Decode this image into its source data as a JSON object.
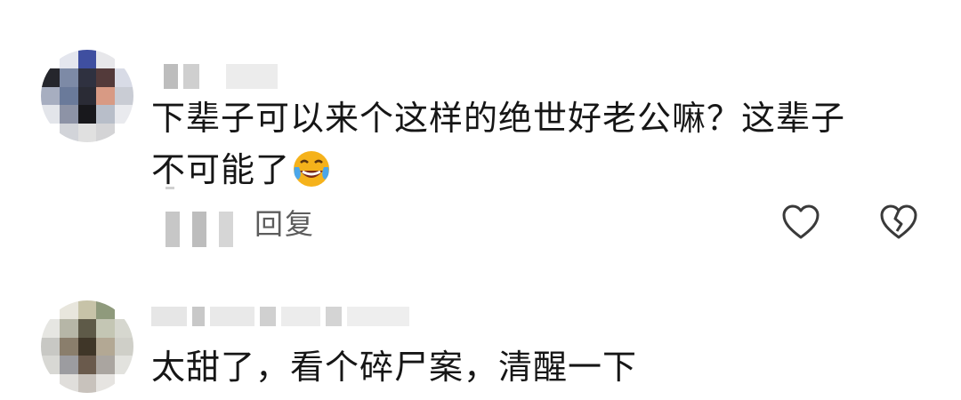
{
  "comments": [
    {
      "text_line1": "下辈子可以来个这样的绝世好老公嘛？这辈子",
      "text_line2": "不可能了",
      "emoji": "laughing-tears-emoji",
      "reply_label": "回复",
      "like_icon": "heart-outline-icon",
      "dislike_icon": "broken-heart-icon"
    },
    {
      "text_line1": "太甜了，看个碎尸案，清醒一下"
    }
  ],
  "colors": {
    "text": "#161616",
    "secondary_text": "#5c5c5c",
    "icon": "#3a3a3a",
    "emoji_face": "#f5b21b"
  }
}
